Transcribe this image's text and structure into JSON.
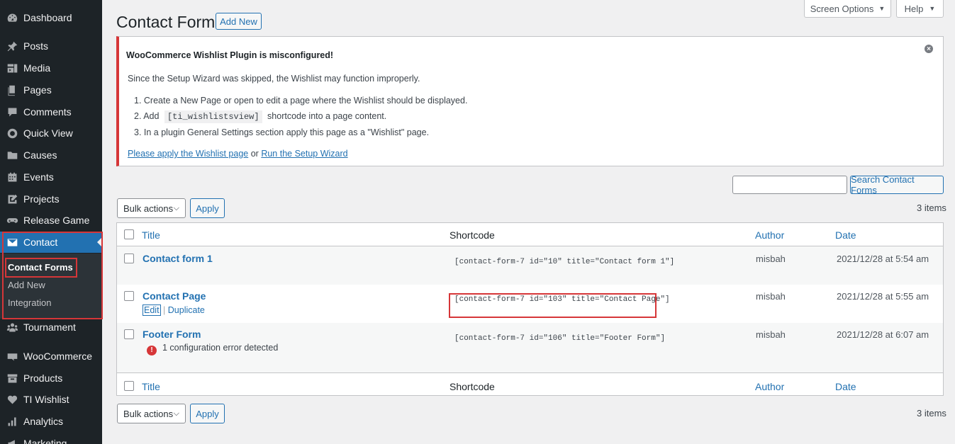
{
  "sidebar": {
    "items": [
      {
        "label": "Dashboard",
        "icon": "dashboard-icon"
      },
      {
        "label": "Posts",
        "icon": "pin-icon"
      },
      {
        "label": "Media",
        "icon": "media-icon"
      },
      {
        "label": "Pages",
        "icon": "pages-icon"
      },
      {
        "label": "Comments",
        "icon": "comments-icon"
      },
      {
        "label": "Quick View",
        "icon": "circle-icon"
      },
      {
        "label": "Causes",
        "icon": "folder-icon"
      },
      {
        "label": "Events",
        "icon": "calendar-icon"
      },
      {
        "label": "Projects",
        "icon": "edit-icon"
      },
      {
        "label": "Release Game",
        "icon": "gamepad-icon"
      },
      {
        "label": "Contact",
        "icon": "mail-icon"
      },
      {
        "label": "Tournament",
        "icon": "group-icon"
      },
      {
        "label": "WooCommerce",
        "icon": "woo-icon"
      },
      {
        "label": "Products",
        "icon": "archive-icon"
      },
      {
        "label": "TI Wishlist",
        "icon": "heart-icon"
      },
      {
        "label": "Analytics",
        "icon": "chart-icon"
      },
      {
        "label": "Marketing",
        "icon": "megaphone-icon"
      }
    ],
    "submenu": [
      "Contact Forms",
      "Add New",
      "Integration"
    ]
  },
  "header": {
    "title": "Contact Forms",
    "add_new": "Add New",
    "screen_options": "Screen Options",
    "help": "Help"
  },
  "notice": {
    "title": "WooCommerce Wishlist Plugin is misconfigured!",
    "intro": "Since the Setup Wizard was skipped, the Wishlist may function improperly.",
    "step1": "1. Create a New Page or open to edit a page where the Wishlist should be displayed.",
    "step2_pre": "2. Add",
    "step2_code": "[ti_wishlistsview]",
    "step2_post": "shortcode into a page content.",
    "step3": "3. In a plugin General Settings section apply this page as a \"Wishlist\" page.",
    "link1": "Please apply the Wishlist page",
    "or": "or",
    "link2": "Run the Setup Wizard"
  },
  "search": {
    "button": "Search Contact Forms",
    "value": ""
  },
  "tablenav": {
    "bulk_actions": "Bulk actions",
    "apply": "Apply",
    "count": "3 items"
  },
  "table": {
    "columns": {
      "title": "Title",
      "shortcode": "Shortcode",
      "author": "Author",
      "date": "Date"
    },
    "rows": [
      {
        "title": "Contact form 1",
        "shortcode": "[contact-form-7 id=\"10\" title=\"Contact form 1\"]",
        "author": "misbah",
        "date": "2021/12/28 at 5:54 am"
      },
      {
        "title": "Contact Page",
        "shortcode": "[contact-form-7 id=\"103\" title=\"Contact Page\"]",
        "author": "misbah",
        "date": "2021/12/28 at 5:55 am",
        "actions": {
          "edit": "Edit",
          "sep": "|",
          "duplicate": "Duplicate"
        }
      },
      {
        "title": "Footer Form",
        "shortcode": "[contact-form-7 id=\"106\" title=\"Footer Form\"]",
        "author": "misbah",
        "date": "2021/12/28 at 6:07 am",
        "error": "1 configuration error detected"
      }
    ]
  },
  "colors": {
    "accent": "#2271b1",
    "highlight": "#d63638",
    "sidebar": "#1d2327"
  }
}
